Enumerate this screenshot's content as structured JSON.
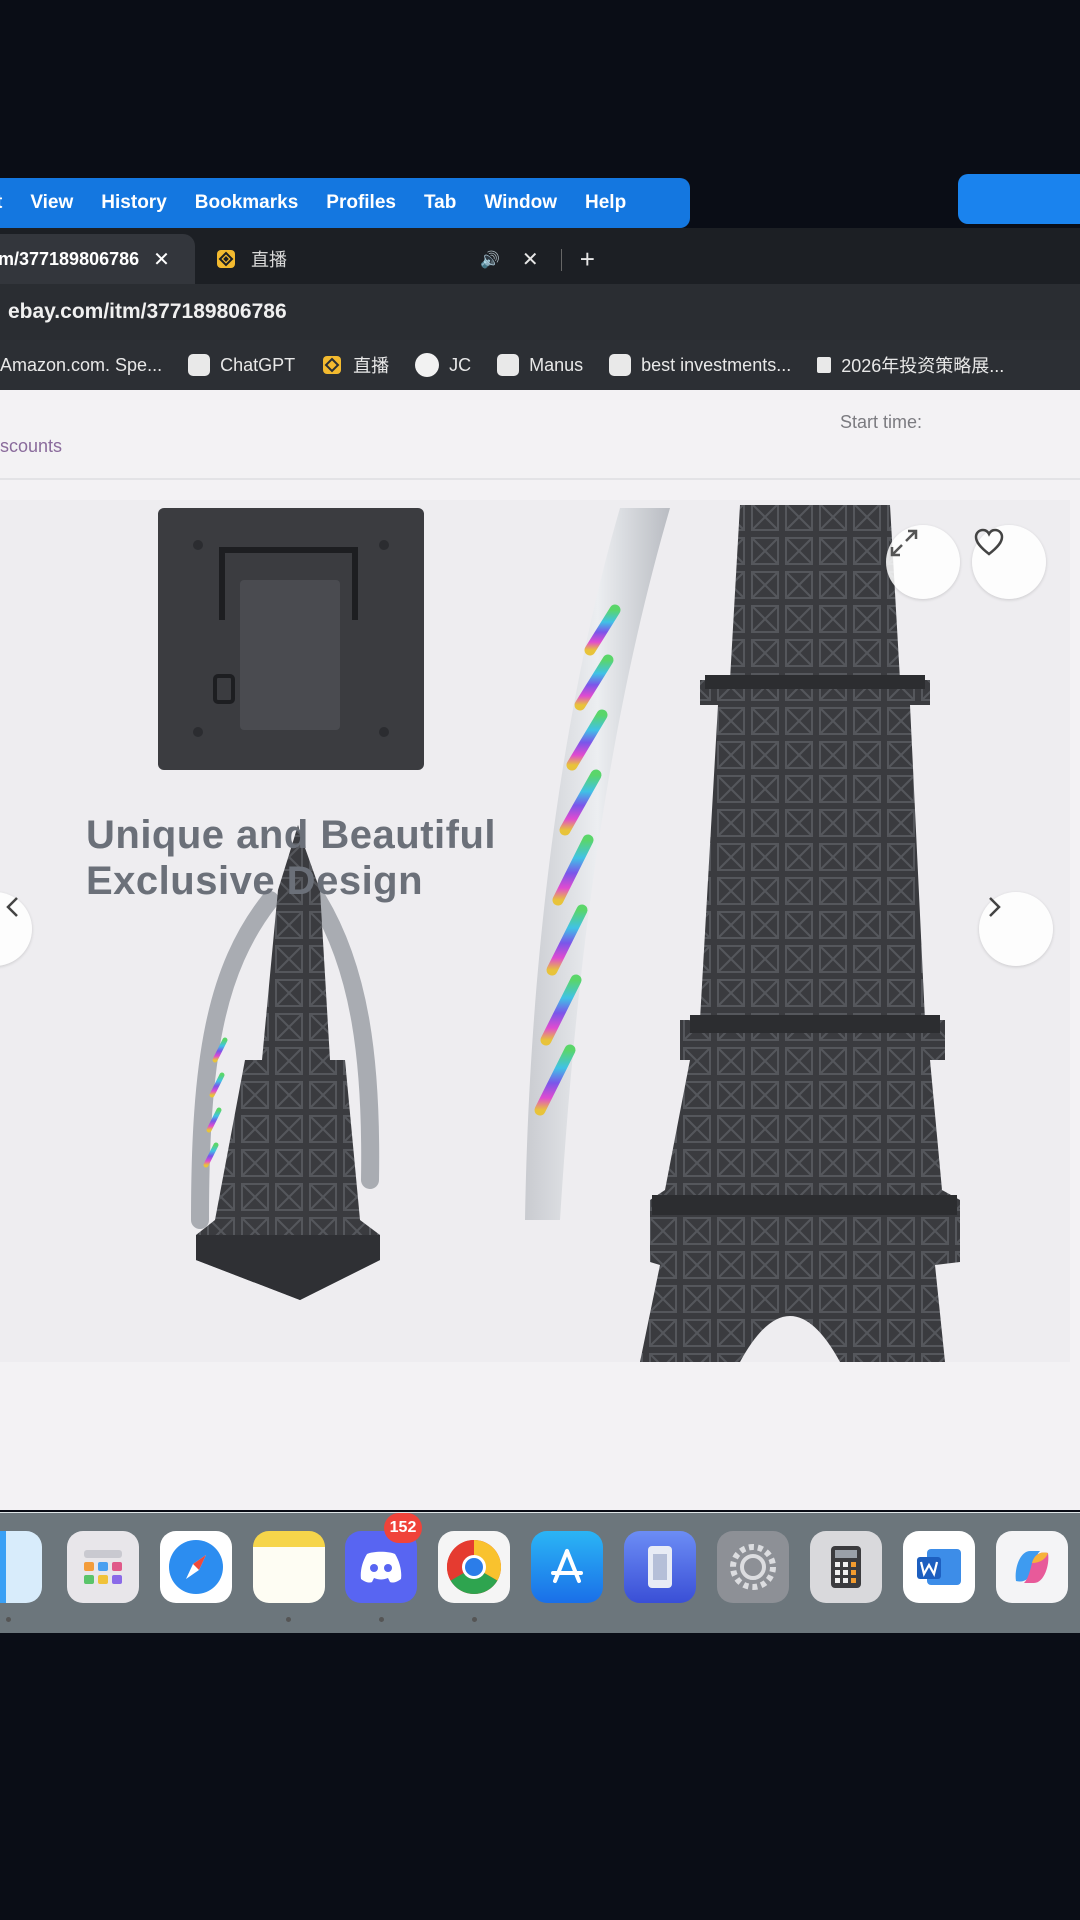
{
  "menu": {
    "items": [
      "t",
      "View",
      "History",
      "Bookmarks",
      "Profiles",
      "Tab",
      "Window",
      "Help"
    ]
  },
  "tabs": {
    "active_title": "m/377189806786",
    "active_close": "✕",
    "second_title": "直播",
    "mute_icon": "🔊",
    "close_icon": "✕",
    "new_tab": "+"
  },
  "address": {
    "url": "ebay.com/itm/377189806786"
  },
  "bookmarks": [
    {
      "label": "Amazon.com. Spe...",
      "icon": "none"
    },
    {
      "label": "ChatGPT",
      "icon": "chatgpt-icon"
    },
    {
      "label": "直播",
      "icon": "binance-icon"
    },
    {
      "label": "JC",
      "icon": "nike-icon"
    },
    {
      "label": "Manus",
      "icon": "manus-icon"
    },
    {
      "label": "best investments...",
      "icon": "chatgpt-icon"
    },
    {
      "label": "2026年投资策略展...",
      "icon": "doc-icon"
    }
  ],
  "page": {
    "discounts_link": "scounts",
    "start_time_label": "Start time:",
    "headline_line1": "Unique and Beautiful",
    "headline_line2": "Exclusive Design"
  },
  "dock": {
    "apps": [
      "finder",
      "launchpad",
      "safari",
      "notes",
      "discord",
      "chrome",
      "app-store",
      "simulator",
      "system-settings",
      "calculator",
      "word",
      "copilot"
    ],
    "discord_badge": "152"
  },
  "colors": {
    "menu_bar": "#1477e0",
    "tab_bar": "#1c1f24",
    "address_bar": "#2a2d32"
  }
}
